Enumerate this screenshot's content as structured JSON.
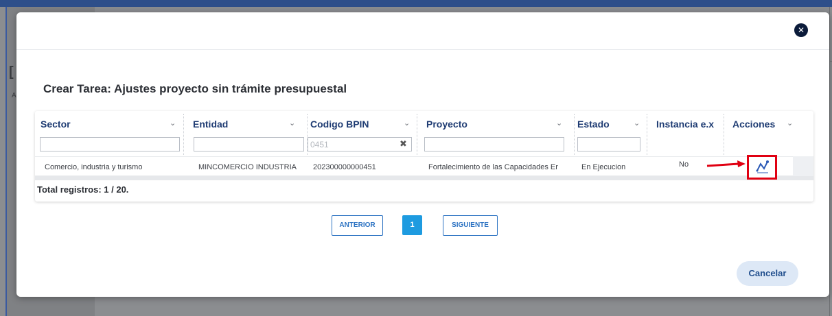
{
  "background": {
    "heading_fragment": "[",
    "sub_fragment": "A"
  },
  "modal": {
    "title": "Crear Tarea: Ajustes proyecto sin trámite presupuestal",
    "close_icon": "close-icon"
  },
  "grid": {
    "columns": [
      {
        "label": "Sector",
        "filter_value": ""
      },
      {
        "label": "Entidad",
        "filter_value": ""
      },
      {
        "label": "Codigo BPIN",
        "filter_value": "0451"
      },
      {
        "label": "Proyecto",
        "filter_value": ""
      },
      {
        "label": "Estado",
        "filter_value": ""
      },
      {
        "label": "Instancia e.x"
      },
      {
        "label": "Acciones"
      }
    ],
    "rows": [
      {
        "sector": "Comercio, industria y turismo",
        "entidad": "MINCOMERCIO INDUSTRIA",
        "bpin": "202300000000451",
        "proyecto": "Fortalecimiento de las Capacidades Er",
        "estado": "En Ejecucion",
        "instancia": "No",
        "action_icon": "chart-line-icon"
      }
    ],
    "total": "Total registros: 1 / 20."
  },
  "pagination": {
    "prev": "ANTERIOR",
    "current": "1",
    "next": "SIGUIENTE"
  },
  "footer": {
    "cancel": "Cancelar"
  },
  "colors": {
    "header_text": "#1f3c73",
    "highlight": "#e00012",
    "primary": "#2b72c2",
    "page_active": "#1e9be0"
  }
}
